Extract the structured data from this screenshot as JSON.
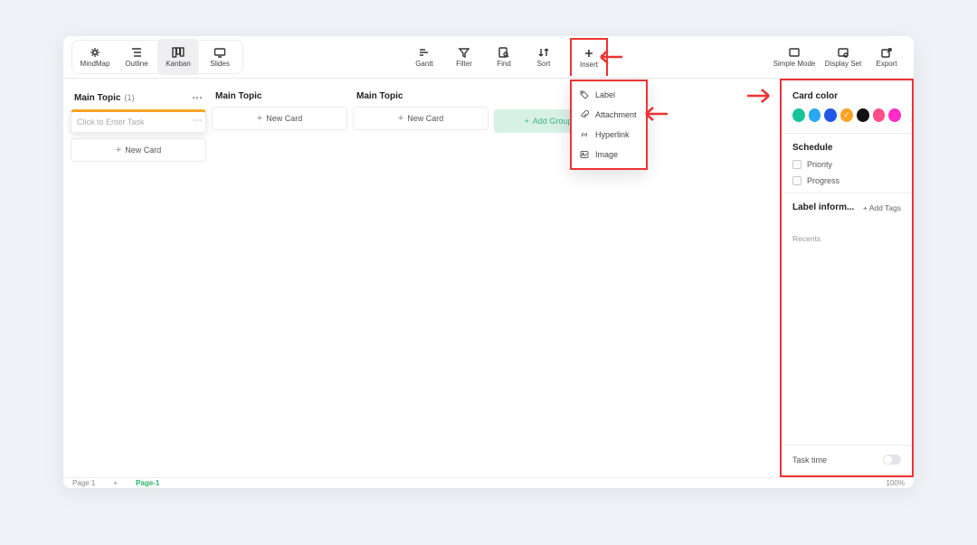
{
  "modes": {
    "mindmap": "MindMap",
    "outline": "Outline",
    "kanban": "Kanban",
    "slides": "Slides"
  },
  "tools": {
    "gantt": "Gantt",
    "filter": "Filter",
    "find": "Find",
    "sort": "Sort",
    "insert": "Insert",
    "simple": "Simple Mode",
    "display": "Display Set",
    "export": "Export"
  },
  "insert_menu": {
    "label": "Label",
    "attachment": "Attachment",
    "hyperlink": "Hyperlink",
    "image": "Image"
  },
  "columns": [
    {
      "title": "Main Topic",
      "count": "(1)"
    },
    {
      "title": "Main Topic"
    },
    {
      "title": "Main Topic"
    }
  ],
  "task_placeholder": "Click to Enter Task",
  "new_card": "New Card",
  "add_group": "Add Group",
  "panel": {
    "card_color": "Card color",
    "schedule": "Schedule",
    "priority": "Priority",
    "progress": "Progress",
    "label_info": "Label inform...",
    "add_tags": "+ Add Tags",
    "recents": "Recents",
    "task_time": "Task time",
    "colors": [
      "#17c39b",
      "#2aa8f2",
      "#2257e6",
      "#ffa224",
      "#111111",
      "#ff4f86",
      "#ff2cc6"
    ],
    "selected_color_index": 3
  },
  "footer": {
    "page_left": "Page 1",
    "page_tab": "Page-1",
    "zoom": "100%"
  }
}
